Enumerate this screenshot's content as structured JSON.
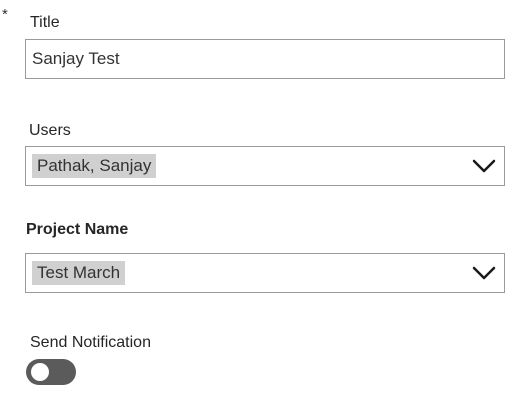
{
  "form": {
    "required_marker": "*",
    "title": {
      "label": "Title",
      "value": "Sanjay Test "
    },
    "users": {
      "label": "Users",
      "selected": "Pathak, Sanjay"
    },
    "project_name": {
      "label": "Project Name",
      "selected": "Test March"
    },
    "send_notification": {
      "label": "Send Notification",
      "enabled": false
    }
  },
  "colors": {
    "toggle_off": "#5b5b5b",
    "chip_background": "#d0d0d0",
    "field_border": "#9a9a9a"
  },
  "icons": {
    "dropdown_indicator": "chevron-down-icon"
  }
}
